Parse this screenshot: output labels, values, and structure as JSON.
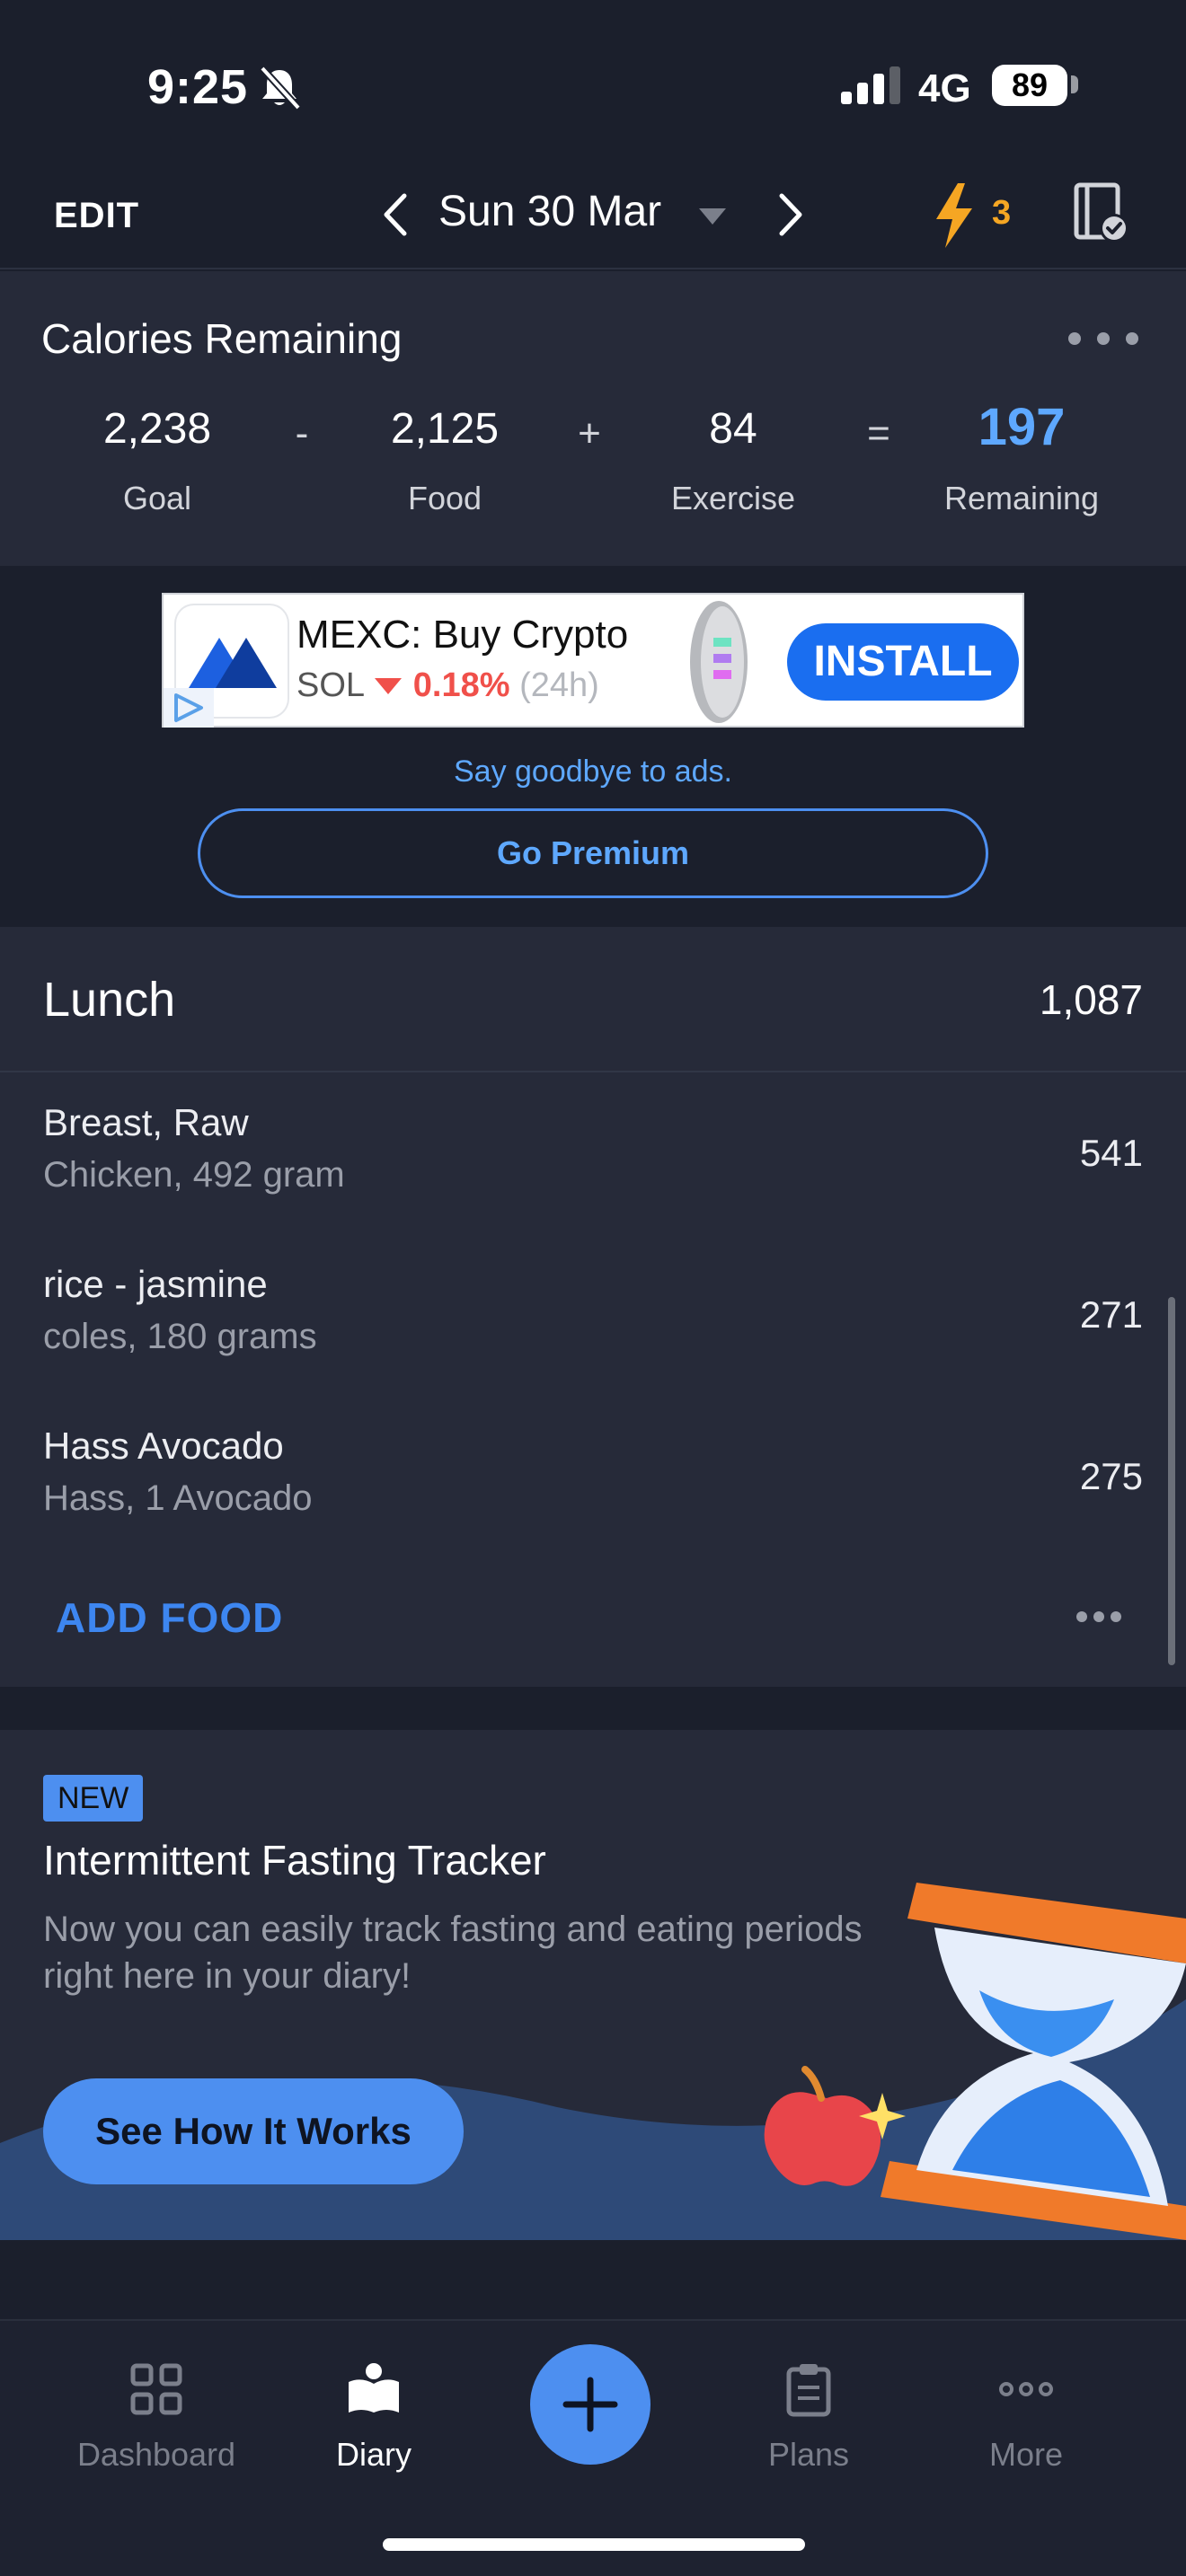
{
  "status_bar": {
    "time": "9:25",
    "network": "4G",
    "battery": "89"
  },
  "header": {
    "edit_label": "EDIT",
    "date": "Sun 30 Mar",
    "streak": "3",
    "accent": "#f5a623"
  },
  "calories": {
    "title": "Calories Remaining",
    "goal_value": "2,238",
    "goal_label": "Goal",
    "food_value": "2,125",
    "food_label": "Food",
    "exercise_value": "84",
    "exercise_label": "Exercise",
    "remaining_value": "197",
    "remaining_label": "Remaining",
    "op_minus": "-",
    "op_plus": "+",
    "op_equals": "="
  },
  "ad": {
    "title": "MEXC: Buy Crypto",
    "ticker": "SOL",
    "change": "0.18%",
    "period": "(24h)",
    "install_label": "INSTALL",
    "say_goodbye": "Say goodbye to ads.",
    "premium_label": "Go Premium"
  },
  "meal": {
    "title": "Lunch",
    "total": "1,087",
    "items": [
      {
        "name": "Breast, Raw",
        "detail": "Chicken, 492 gram",
        "calories": "541"
      },
      {
        "name": "rice - jasmine",
        "detail": "coles, 180 grams",
        "calories": "271"
      },
      {
        "name": "Hass Avocado",
        "detail": "Hass, 1 Avocado",
        "calories": "275"
      }
    ],
    "add_food_label": "ADD FOOD"
  },
  "promo": {
    "badge": "NEW",
    "title": "Intermittent Fasting Tracker",
    "description": "Now you can easily track fasting and eating periods right here in your diary!",
    "button_label": "See How It Works"
  },
  "tabs": [
    {
      "label": "Dashboard",
      "icon": "dashboard-icon",
      "active": false
    },
    {
      "label": "Diary",
      "icon": "diary-icon",
      "active": true
    },
    {
      "label": "Plans",
      "icon": "plans-icon",
      "active": false
    },
    {
      "label": "More",
      "icon": "more-icon",
      "active": false
    }
  ],
  "colors": {
    "accent_blue": "#4d8ff0",
    "remaining_blue": "#5ea8ff",
    "background": "#1b1f2c",
    "card": "#262a39"
  }
}
